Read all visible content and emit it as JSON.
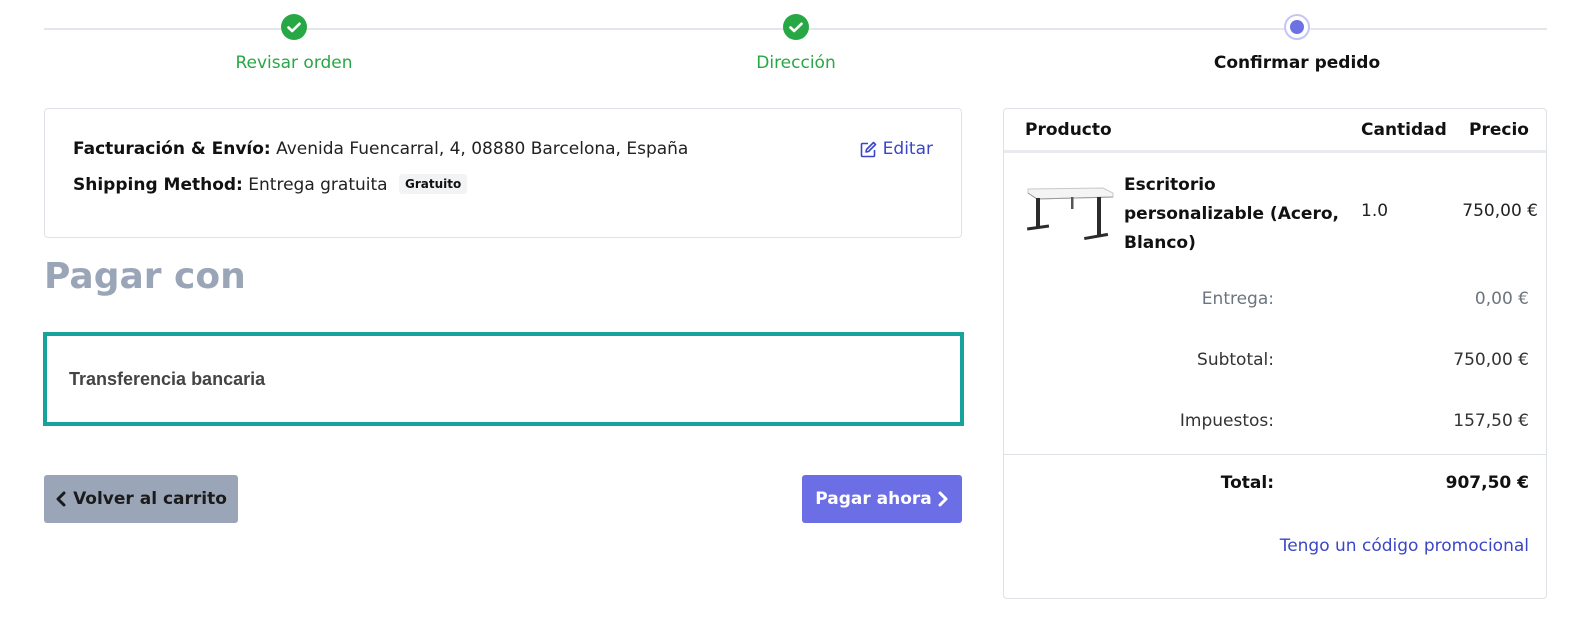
{
  "wizard": {
    "steps": [
      {
        "label": "Revisar orden",
        "state": "done"
      },
      {
        "label": "Dirección",
        "state": "done"
      },
      {
        "label": "Confirmar pedido",
        "state": "current"
      }
    ]
  },
  "address": {
    "billing_label": "Facturación & Envío:",
    "billing_value": "Avenida Fuencarral, 4, 08880 Barcelona, España",
    "shipping_label": "Shipping Method:",
    "shipping_value": "Entrega gratuita",
    "shipping_badge": "Gratuito",
    "edit_label": "Editar"
  },
  "payment": {
    "title": "Pagar con",
    "option_label": "Transferencia bancaria",
    "back_label": "Volver al carrito",
    "pay_label": "Pagar ahora"
  },
  "summary": {
    "headers": {
      "product": "Producto",
      "quantity": "Cantidad",
      "price": "Precio"
    },
    "product": {
      "name": "Escritorio personalizable (Acero, Blanco)",
      "quantity": "1.0",
      "price": "750,00 €"
    },
    "delivery_label": "Entrega:",
    "delivery_value": "0,00 €",
    "subtotal_label": "Subtotal:",
    "subtotal_value": "750,00 €",
    "taxes_label": "Impuestos:",
    "taxes_value": "157,50 €",
    "total_label": "Total:",
    "total_value": "907,50 €",
    "promo_label": "Tengo un código promocional"
  },
  "colors": {
    "done_green": "#28a745",
    "accent_purple": "#6c6ee5",
    "selected_teal": "#17a29b",
    "link_blue": "#3b46c7",
    "muted_gray": "#9aa6b8"
  }
}
